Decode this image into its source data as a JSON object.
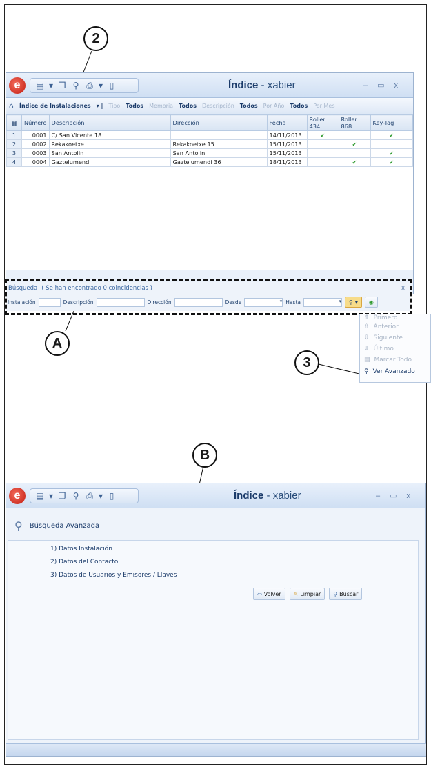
{
  "callouts": {
    "c2": "2",
    "cA": "A",
    "c3": "3",
    "cB": "B"
  },
  "win1": {
    "title_main": "Índice",
    "title_sep": " - ",
    "title_user": "xabier",
    "ribbon": {
      "index_label": "Índice de Instalaciones",
      "tipo": "Tipo",
      "todos1": "Todos",
      "memoria": "Memoria",
      "todos2": "Todos",
      "descripcion": "Descripción",
      "todos3": "Todos",
      "por_ano": "Por Año",
      "todos4": "Todos",
      "por_mes": "Por Mes"
    },
    "columns": [
      "Número",
      "Descripción",
      "Dirección",
      "Fecha",
      "Roller 434",
      "Roller 868",
      "Key-Tag"
    ],
    "rows": [
      {
        "n": "1",
        "num": "0001",
        "desc": "C/ San Vicente 18",
        "dir": "",
        "fecha": "14/11/2013",
        "r434": "✔",
        "r868": "",
        "key": "✔"
      },
      {
        "n": "2",
        "num": "0002",
        "desc": "Rekakoetxe",
        "dir": "Rekakoetxe 15",
        "fecha": "15/11/2013",
        "r434": "",
        "r868": "✔",
        "key": ""
      },
      {
        "n": "3",
        "num": "0003",
        "desc": "San Antolin",
        "dir": "San Antolin",
        "fecha": "15/11/2013",
        "r434": "",
        "r868": "",
        "key": "✔"
      },
      {
        "n": "4",
        "num": "0004",
        "desc": "Gaztelumendi",
        "dir": "Gaztelumendi 36",
        "fecha": "18/11/2013",
        "r434": "",
        "r868": "✔",
        "key": "✔"
      }
    ],
    "search": {
      "title": "Búsqueda",
      "status": "( Se han encontrado 0 coincidencias )",
      "close": "x",
      "instalacion": "Instalación",
      "descripcion": "Descripción",
      "direccion": "Dirección",
      "desde": "Desde",
      "hasta": "Hasta"
    }
  },
  "menu": {
    "items": [
      {
        "label": "Primero",
        "enabled": false
      },
      {
        "label": "Anterior",
        "enabled": false
      },
      {
        "label": "Siguiente",
        "enabled": false
      },
      {
        "label": "Último",
        "enabled": false
      },
      {
        "label": "Marcar Todo",
        "enabled": false
      },
      {
        "label": "Ver Avanzado",
        "enabled": true
      }
    ]
  },
  "win2": {
    "title_main": "Índice",
    "title_sep": " - ",
    "title_user": "xabier",
    "heading": "Búsqueda Avanzada",
    "sections": [
      "1) Datos Instalación",
      "2) Datos del Contacto",
      "3) Datos de Usuarios y Emisores / Llaves"
    ],
    "buttons": {
      "volver": "Volver",
      "limpiar": "Limpiar",
      "buscar": "Buscar"
    }
  },
  "colors": {
    "accent": "#1b3b6a",
    "check": "#2e9a2e",
    "logo": "#c21d12"
  }
}
